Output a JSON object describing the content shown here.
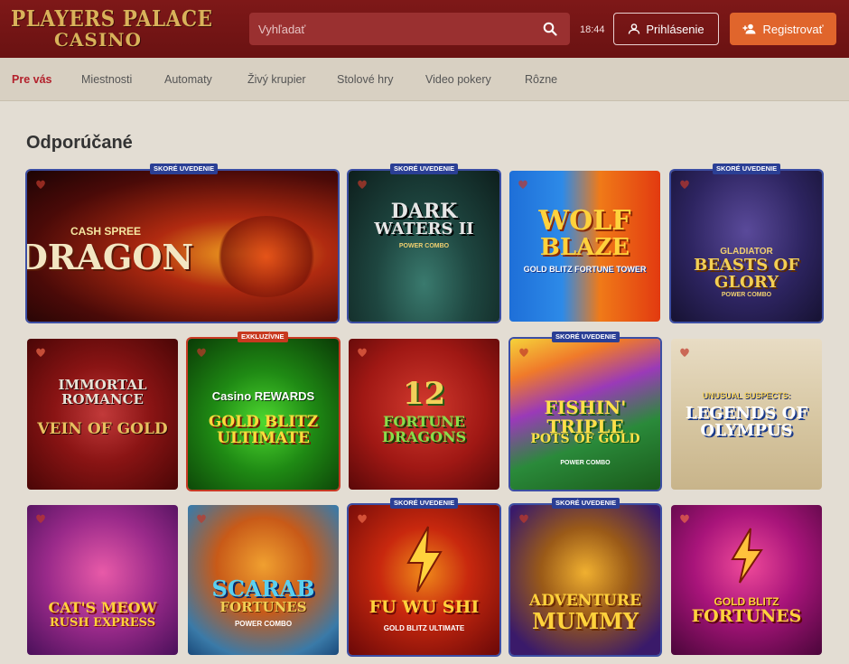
{
  "header": {
    "logo_line1": "PLAYERS PALACE",
    "logo_line2": "CASINO",
    "search_placeholder": "Vyhľadať",
    "clock": "18:44",
    "login_label": "Prihlásenie",
    "register_label": "Registrovať",
    "colors": {
      "header_bg": "#7e1818",
      "register_bg": "#e0652c",
      "search_bg": "#9a3030"
    }
  },
  "nav": {
    "tabs": [
      "Pre vás",
      "Miestnosti",
      "Automaty",
      "Živý krupier",
      "Stolové hry",
      "Video pokery",
      "Rôzne"
    ],
    "active_index": 0
  },
  "section": {
    "title": "Odporúčané"
  },
  "badges": {
    "soon": "SKORÉ UVEDENIE",
    "exclusive": "EXKLUZÍVNE"
  },
  "games": [
    {
      "line1": "CASH SPREE",
      "line2": "DRAGON",
      "badge": "soon"
    },
    {
      "line1": "DARK",
      "line2": "WATERS II",
      "sub": "POWER COMBO",
      "badge": "soon"
    },
    {
      "line1": "WOLF",
      "line2": "BLAZE",
      "sub": "GOLD BLITZ FORTUNE TOWER"
    },
    {
      "line1": "GLADIATOR",
      "line2": "BEASTS OF GLORY",
      "sub": "POWER COMBO",
      "badge": "soon"
    },
    {
      "line1": "IMMORTAL ROMANCE",
      "line2": "VEIN OF GOLD"
    },
    {
      "line1": "Casino REWARDS",
      "line2": "GOLD BLITZ ULTIMATE",
      "badge": "exclusive"
    },
    {
      "line1": "12",
      "line2": "FORTUNE DRAGONS"
    },
    {
      "line1": "FISHIN' TRIPLE",
      "line2": "POTS OF GOLD",
      "sub": "POWER COMBO",
      "badge": "soon"
    },
    {
      "line1": "UNUSUAL SUSPECTS:",
      "line2": "LEGENDS OF OLYMPUS"
    },
    {
      "line1": "CAT'S MEOW",
      "line2": "RUSH EXPRESS"
    },
    {
      "line1": "SCARAB",
      "line2": "FORTUNES",
      "sub": "POWER COMBO"
    },
    {
      "line1": "FU WU SHI",
      "line2": "GOLD BLITZ ULTIMATE",
      "badge": "soon"
    },
    {
      "line1": "ADVENTURE",
      "line2": "MUMMY",
      "badge": "soon"
    },
    {
      "line1": "GOLD BLITZ",
      "line2": "FORTUNES"
    }
  ]
}
